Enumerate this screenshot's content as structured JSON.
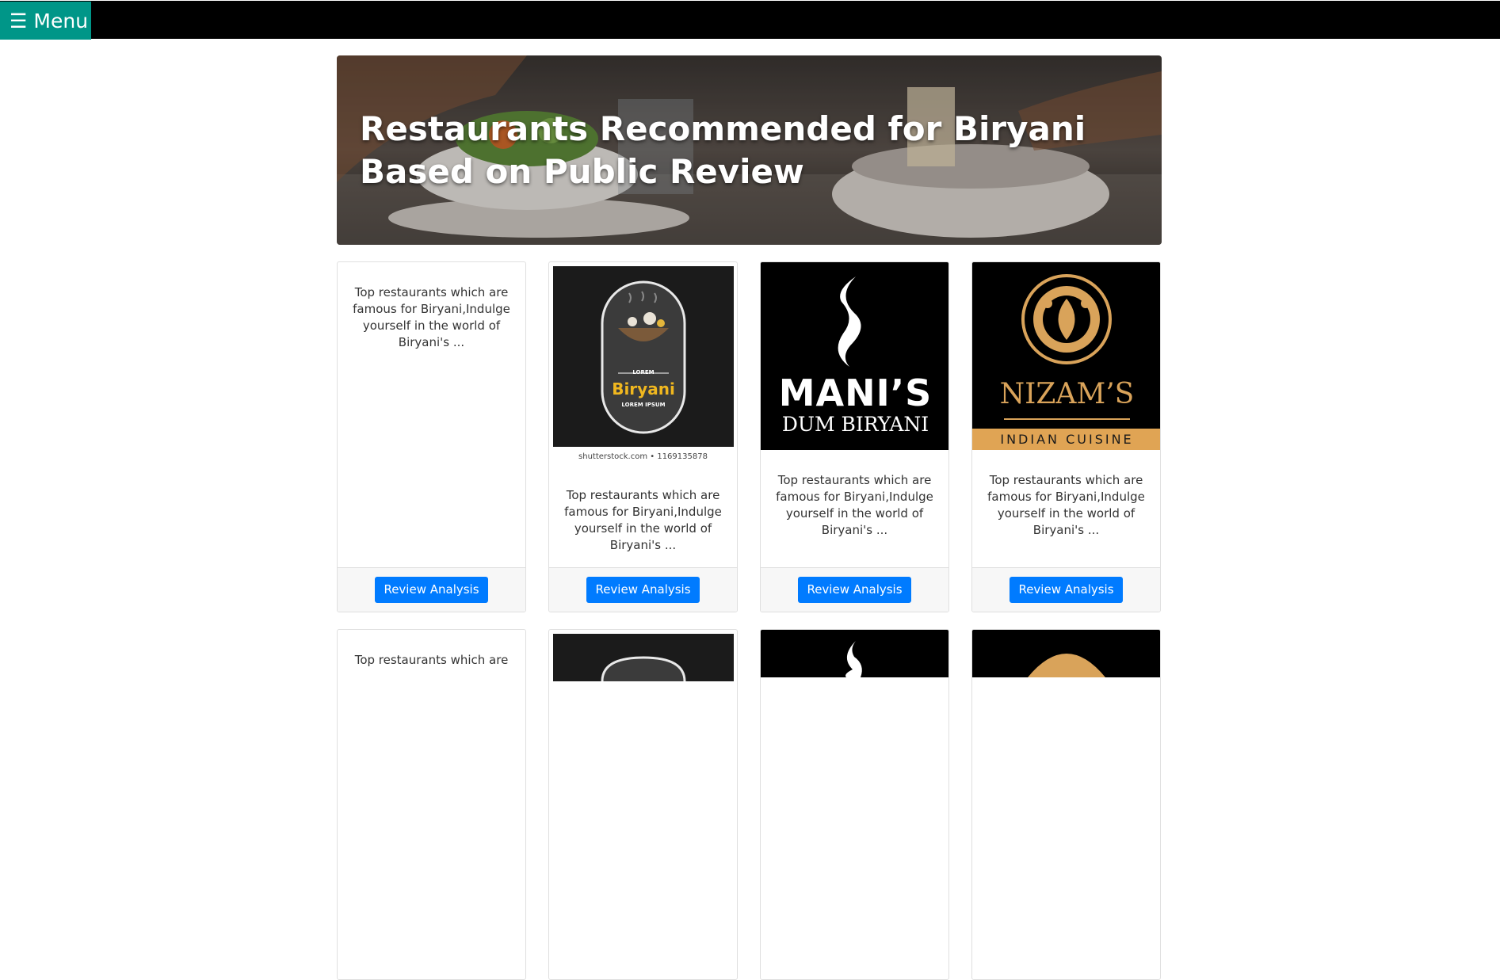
{
  "menu": {
    "icon": "hamburger-icon",
    "label": "Menu",
    "burger": "☰"
  },
  "hero": {
    "title": "Restaurants Recommended for Biryani Based on Public Review"
  },
  "cards": [
    {
      "description": "Top restaurants which are famous for Biryani,Indulge yourself in the world of Biryani's ...",
      "button": "Review Analysis"
    },
    {
      "description": "Top restaurants which are famous for Biryani,Indulge yourself in the world of Biryani's ...",
      "button": "Review Analysis",
      "logo": {
        "top_small": "LOREM",
        "name": "Biryani",
        "sub": "LOREM IPSUM",
        "caption": "shutterstock.com • 1169135878"
      }
    },
    {
      "description": "Top restaurants which are famous for Biryani,Indulge yourself in the world of Biryani's ...",
      "button": "Review Analysis",
      "logo": {
        "line1": "MANI’S",
        "line2": "DUM BIRYANI"
      }
    },
    {
      "description": "Top restaurants which are famous for Biryani,Indulge yourself in the world of Biryani's ...",
      "button": "Review Analysis",
      "logo": {
        "name": "NIZAM’S",
        "banner": "INDIAN CUISINE"
      }
    }
  ],
  "row2": {
    "first_text": "Top restaurants which are"
  },
  "colors": {
    "menu_bg": "#009688",
    "button_bg": "#007bff",
    "gold": "#d9a35a"
  }
}
